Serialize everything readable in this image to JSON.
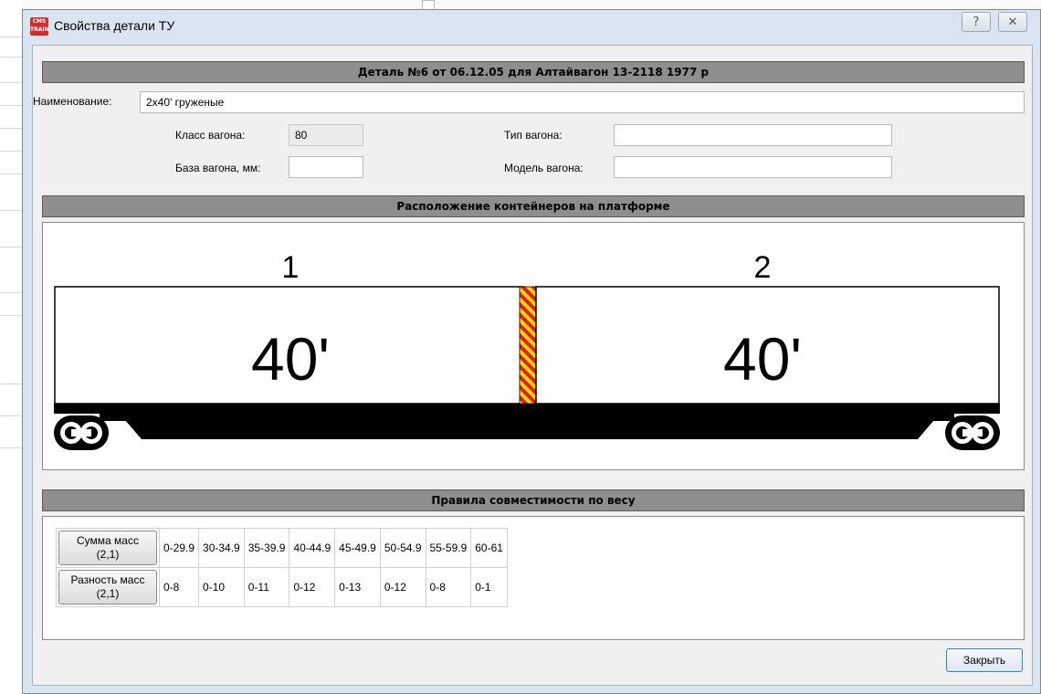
{
  "window": {
    "title": "Свойства детали ТУ",
    "icon_name": "cmstrain-app-icon",
    "icon_text": "CMS TRAIN",
    "help_glyph": "?",
    "close_glyph": "✕"
  },
  "header": {
    "title": "Деталь №6 от 06.12.05 для Алтайвагон 13-2118 1977 р"
  },
  "fields": {
    "name_label": "Наименование:",
    "name_value": "2x40' груженые",
    "wagon_class_label": "Класс вагона:",
    "wagon_class_value": "80",
    "wagon_base_label": "База вагона, мм:",
    "wagon_base_value": "",
    "wagon_type_label": "Тип вагона:",
    "wagon_type_value": "",
    "wagon_model_label": "Модель вагона:",
    "wagon_model_value": ""
  },
  "layout_section": {
    "title": "Расположение контейнеров на платформе",
    "containers": [
      {
        "number": "1",
        "size": "40'"
      },
      {
        "number": "2",
        "size": "40'"
      }
    ]
  },
  "rules_section": {
    "title": "Правила совместимости по весу",
    "rows": [
      {
        "label_line1": "Сумма масс",
        "label_line2": "(2,1)",
        "cells": [
          "0-29.9",
          "30-34.9",
          "35-39.9",
          "40-44.9",
          "45-49.9",
          "50-54.9",
          "55-59.9",
          "60-61"
        ]
      },
      {
        "label_line1": "Разность масс",
        "label_line2": "(2,1)",
        "cells": [
          "0-8",
          "0-10",
          "0-11",
          "0-12",
          "0-13",
          "0-12",
          "0-8",
          "0-1"
        ]
      }
    ]
  },
  "footer": {
    "close_label": "Закрыть"
  },
  "colors": {
    "section_bar": "#8e8e8e",
    "separator_red": "#e02020",
    "separator_yellow": "#f5d800",
    "accent_border": "#3b7fcf"
  }
}
